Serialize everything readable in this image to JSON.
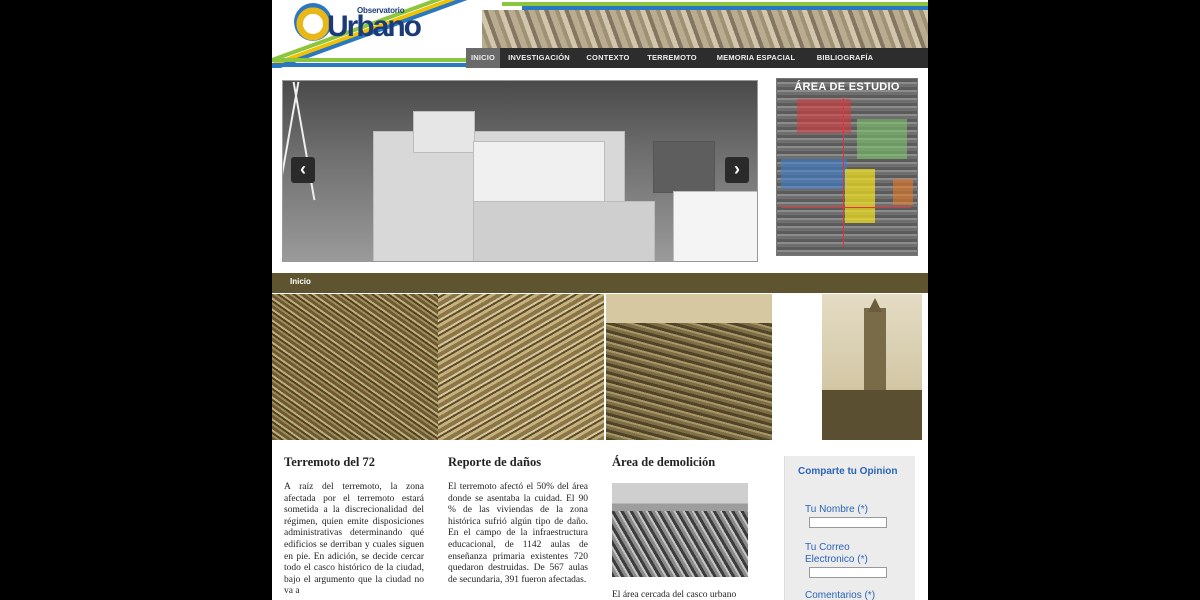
{
  "header": {
    "logo_small": "Observatorio",
    "logo_big": "Urbano",
    "nav": [
      "INICIO",
      "INVESTIGACIÓN",
      "CONTEXTO",
      "TERREMOTO",
      "MEMORIA ESPACIAL",
      "BIBLIOGRAFÍA"
    ],
    "active_nav": "INICIO"
  },
  "slider": {
    "prev_icon": "‹",
    "next_icon": "›"
  },
  "study_area": {
    "title": "ÁREA DE ESTUDIO"
  },
  "section": {
    "label": "Inicio"
  },
  "columns": [
    {
      "title": "Terremoto del 72",
      "text": "A raíz del terremoto, la zona afectada por el terremoto estará sometida a la discrecionalidad del régimen, quien emite disposiciones administrativas determinando qué edificios se derriban y cuales siguen en pie. En adición, se decide cercar todo el casco histórico de la ciudad, bajo el argumento que la ciudad no va a"
    },
    {
      "title": "Reporte de daños",
      "text": "El terremoto afectó el 50% del área donde se asentaba la cuidad. El 90 % de las viviendas de la zona histórica sufrió algún tipo de daño. En el campo de la infraestructura educacional, de 1142 aulas de enseñanza primaria existentes 720 quedaron destruidas. De 567 aulas de secundaria, 391 fueron afectadas."
    },
    {
      "title": "Área de demolición",
      "caption": "El área cercada del casco urbano"
    }
  ],
  "opinion": {
    "title": "Comparte tu Opinion",
    "name_label": "Tu Nombre (*)",
    "email_label": "Tu Correo Electronico (*)",
    "comments_label": "Comentarios (*)"
  },
  "colors": {
    "nav_bg": "#2d2d2d",
    "section_bar": "#5e5530",
    "link_blue": "#2a63b8",
    "stripe_green": "#8cc63f",
    "stripe_blue": "#2a79c0",
    "stripe_yellow": "#f2c200"
  }
}
